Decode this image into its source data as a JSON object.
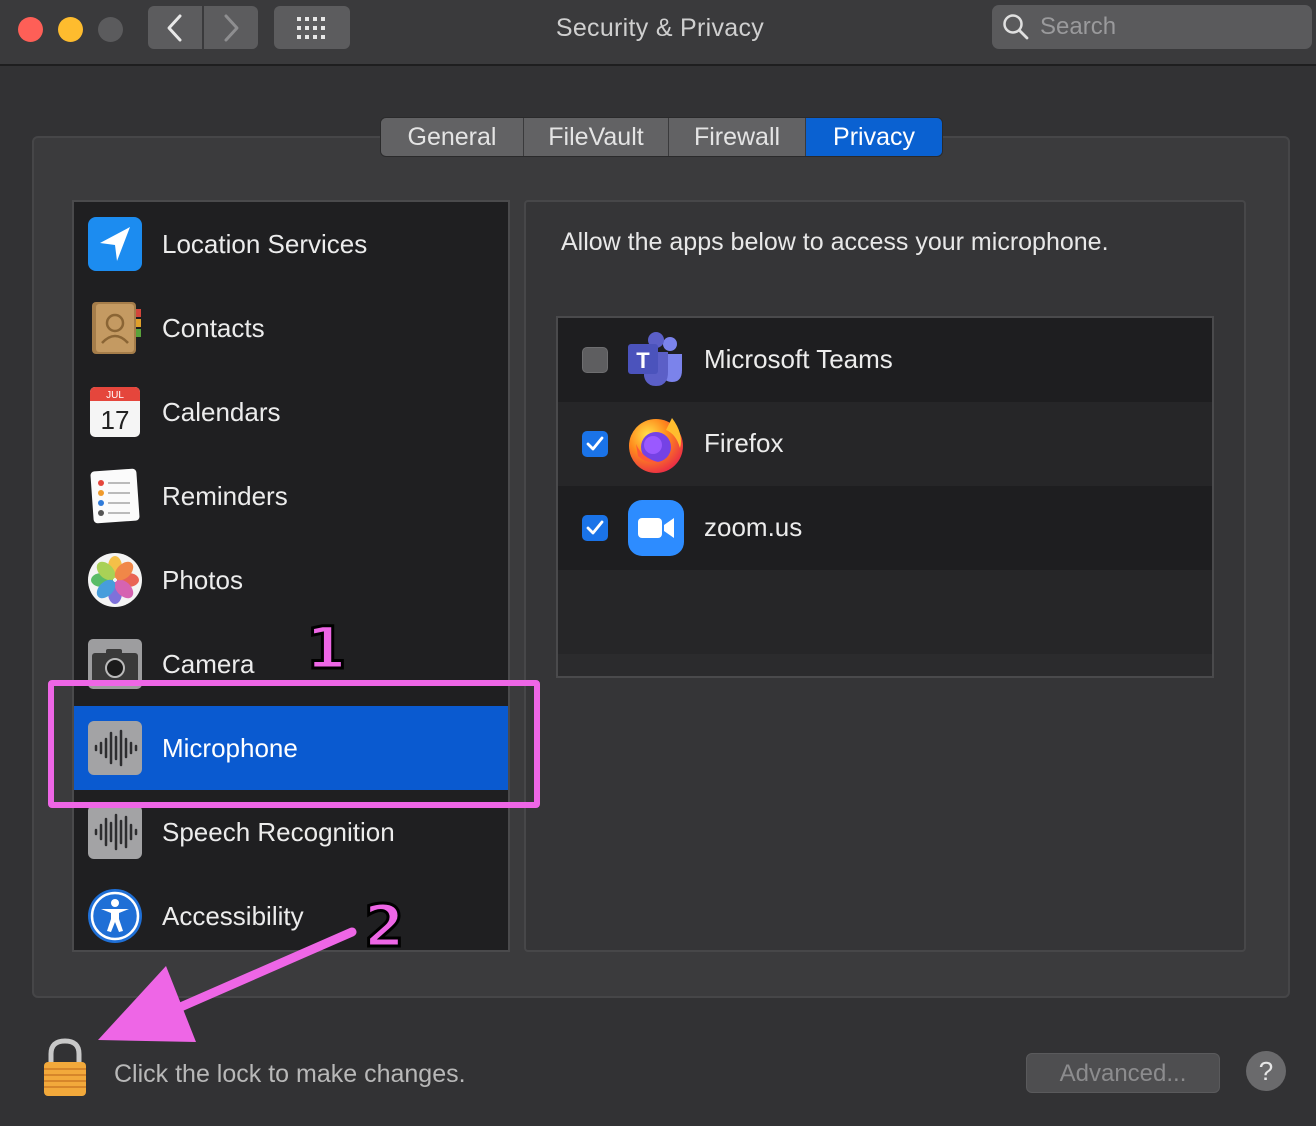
{
  "window": {
    "title": "Security & Privacy"
  },
  "search": {
    "placeholder": "Search"
  },
  "tabs": [
    {
      "label": "General",
      "active": false
    },
    {
      "label": "FileVault",
      "active": false
    },
    {
      "label": "Firewall",
      "active": false
    },
    {
      "label": "Privacy",
      "active": true
    }
  ],
  "categories": [
    {
      "label": "Location Services",
      "icon": "location-arrow-icon"
    },
    {
      "label": "Contacts",
      "icon": "contacts-book-icon"
    },
    {
      "label": "Calendars",
      "icon": "calendar-icon",
      "month": "JUL",
      "day": "17"
    },
    {
      "label": "Reminders",
      "icon": "reminders-list-icon"
    },
    {
      "label": "Photos",
      "icon": "photos-flower-icon"
    },
    {
      "label": "Camera",
      "icon": "camera-icon"
    },
    {
      "label": "Microphone",
      "icon": "microphone-waveform-icon",
      "selected": true
    },
    {
      "label": "Speech Recognition",
      "icon": "speech-waveform-icon"
    },
    {
      "label": "Accessibility",
      "icon": "accessibility-person-icon"
    }
  ],
  "privacy_pane": {
    "description": "Allow the apps below to access your microphone.",
    "apps": [
      {
        "name": "Microsoft Teams",
        "checked": false,
        "icon": "microsoft-teams-icon",
        "icon_letter": "T"
      },
      {
        "name": "Firefox",
        "checked": true,
        "icon": "firefox-icon"
      },
      {
        "name": "zoom.us",
        "checked": true,
        "icon": "zoom-camera-icon"
      }
    ]
  },
  "footer": {
    "lock_text": "Click the lock to make changes.",
    "advanced_label": "Advanced...",
    "help_label": "?"
  },
  "annotations": {
    "step1": "1",
    "step2": "2",
    "color": "#ee66e6"
  },
  "colors": {
    "accent": "#0a61d1",
    "selection": "#0a5ad0"
  }
}
